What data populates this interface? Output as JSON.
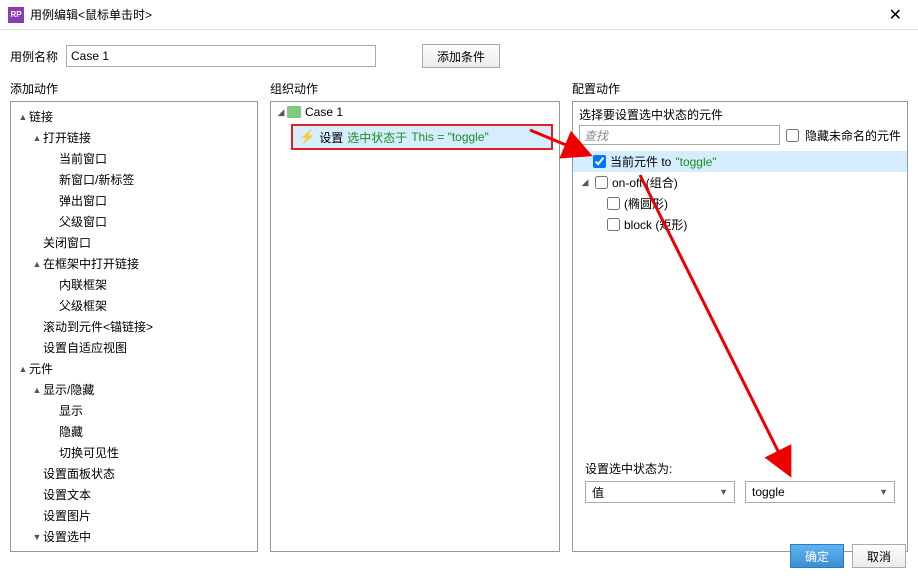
{
  "window": {
    "title": "用例编辑<鼠标单击时>"
  },
  "name_row": {
    "label": "用例名称",
    "value": "Case 1",
    "add_condition": "添加条件"
  },
  "columns": {
    "add": "添加动作",
    "org": "组织动作",
    "cfg": "配置动作"
  },
  "action_tree": {
    "link": "链接",
    "open_link": "打开链接",
    "current_window": "当前窗口",
    "new_window_tab": "新窗口/新标签",
    "popup_window": "弹出窗口",
    "parent_window": "父级窗口",
    "close_window": "关闭窗口",
    "open_in_frame": "在框架中打开链接",
    "inline_frame": "内联框架",
    "parent_frame": "父级框架",
    "scroll_to": "滚动到元件<锚链接>",
    "set_adaptive": "设置自适应视图",
    "widgets": "元件",
    "show_hide": "显示/隐藏",
    "show": "显示",
    "hide": "隐藏",
    "toggle_vis": "切换可见性",
    "set_panel": "设置面板状态",
    "set_text": "设置文本",
    "set_image": "设置图片",
    "set_selected": "设置选中"
  },
  "org": {
    "case": "Case 1",
    "action_prefix": "设置",
    "action_mid": "选中状态于",
    "action_suffix": "This = \"toggle\""
  },
  "cfg": {
    "select_label": "选择要设置选中状态的元件",
    "search_placeholder": "查找",
    "hide_unnamed": "隐藏未命名的元件",
    "current_prefix": "当前元件 to",
    "current_value": "\"toggle\"",
    "onoff": "on-off (组合)",
    "ellipse": "(椭圆形)",
    "block": "block (矩形)",
    "set_state_label": "设置选中状态为:",
    "value_combo": "值",
    "toggle_combo": "toggle"
  },
  "footer": {
    "ok": "确定",
    "cancel": "取消"
  }
}
